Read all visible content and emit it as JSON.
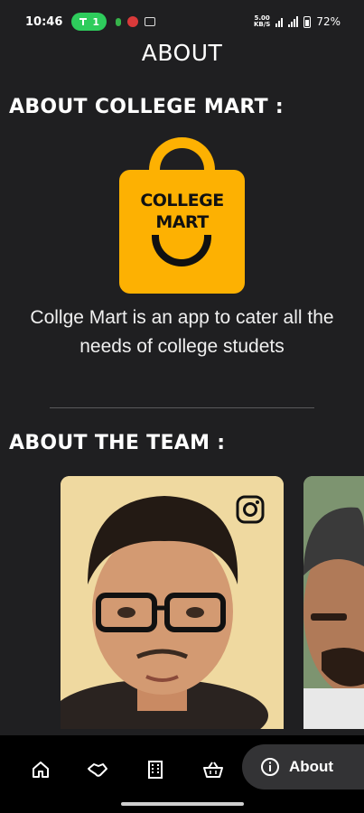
{
  "status_bar": {
    "time": "10:46",
    "call_count": "1",
    "net_speed_top": "5.00",
    "net_speed_bottom": "KB/S",
    "battery": "72%"
  },
  "page": {
    "title": "ABOUT"
  },
  "about_college_mart": {
    "heading": "ABOUT COLLEGE MART :",
    "logo_line1": "COLLEGE",
    "logo_line2": "MART",
    "description": "Collge Mart is an app to cater all the needs of college studets"
  },
  "about_team": {
    "heading": "ABOUT THE TEAM :",
    "members": [
      {
        "social_icon": "instagram-icon"
      },
      {
        "social_icon": "instagram-icon"
      }
    ]
  },
  "bottom_nav": {
    "items": [
      {
        "icon": "home-icon"
      },
      {
        "icon": "handshake-icon"
      },
      {
        "icon": "building-icon"
      },
      {
        "icon": "basket-icon"
      },
      {
        "icon": "info-icon",
        "label": "About",
        "active": true
      }
    ]
  },
  "colors": {
    "background": "#1f1f21",
    "brand_yellow": "#fdb102",
    "nav_background": "#000000",
    "active_pill": "#333335"
  }
}
